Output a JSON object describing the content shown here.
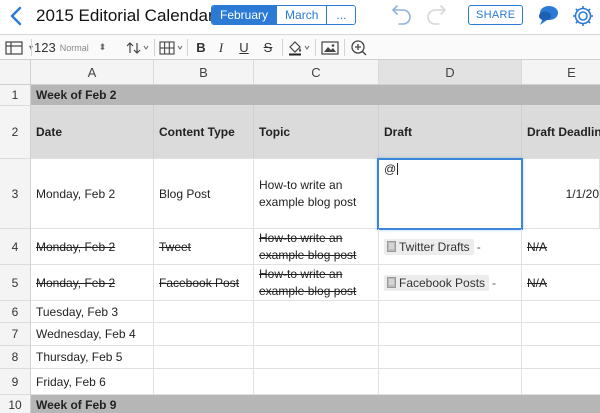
{
  "header": {
    "doc_title": "2015 Editorial Calendar",
    "sheet_tabs": [
      "February",
      "March",
      "..."
    ],
    "share_label": "SHARE"
  },
  "toolbar": {
    "number_format": "123",
    "number_format_name": "Normal",
    "bold": "B",
    "italic": "I",
    "underline": "U",
    "strikethrough": "S"
  },
  "columns": [
    "A",
    "B",
    "C",
    "D",
    "E"
  ],
  "selected_column": "D",
  "rows": [
    "1",
    "2",
    "3",
    "4",
    "5",
    "6",
    "7",
    "8",
    "9",
    "10"
  ],
  "cells": {
    "r1": {
      "a": "Week of Feb 2"
    },
    "r2": {
      "a": "Date",
      "b": "Content Type",
      "c": "Topic",
      "d": "Draft",
      "e": "Draft Deadline"
    },
    "r3": {
      "a": "Monday, Feb 2",
      "b": "Blog Post",
      "c": "How-to write an example blog post",
      "d": "@",
      "e": "1/1/20"
    },
    "r4": {
      "a": "Monday, Feb 2",
      "b": "Tweet",
      "c": "How-to write an example blog post",
      "d": "Twitter Drafts",
      "d_suffix": "-",
      "e": "N/A"
    },
    "r5": {
      "a": "Monday, Feb 2",
      "b": "Facebook Post",
      "c": "How-to write an example blog post",
      "d": "Facebook Posts",
      "d_suffix": "-",
      "e": "N/A"
    },
    "r6": {
      "a": "Tuesday, Feb 3"
    },
    "r7": {
      "a": "Wednesday, Feb 4"
    },
    "r8": {
      "a": "Thursday, Feb 5"
    },
    "r9": {
      "a": "Friday, Feb 6"
    },
    "r10": {
      "a": "Week of Feb 9"
    }
  },
  "colors": {
    "accent": "#2a7ad6",
    "band_row": "#b6b6b6",
    "header_row": "#dbdbdb",
    "selected_column_header": "#e2e2e2",
    "active_cell_border": "#3a86d8"
  }
}
